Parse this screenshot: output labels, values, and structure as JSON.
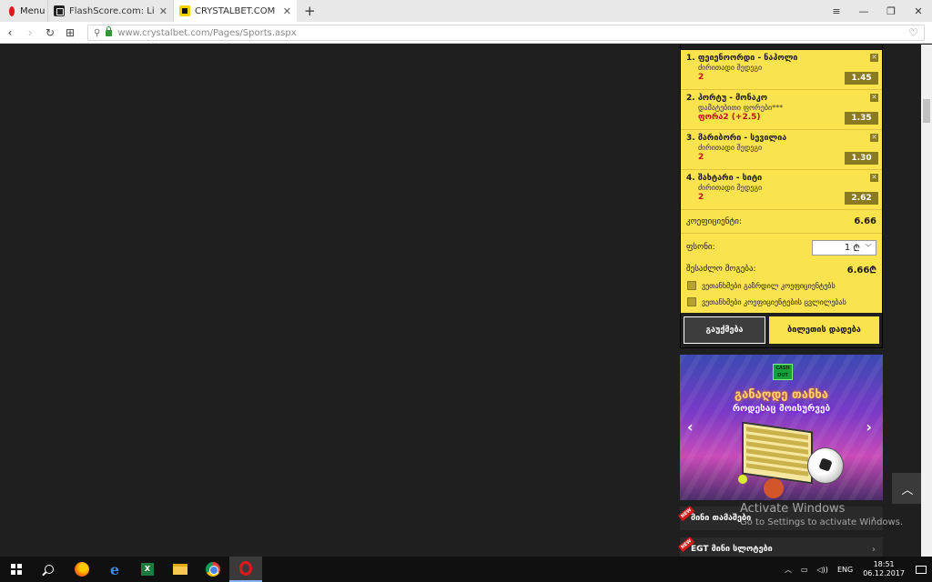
{
  "browser": {
    "menu_label": "Menu",
    "tabs": [
      {
        "title": "FlashScore.com: Live Socc",
        "close": "✕"
      },
      {
        "title": "CRYSTALBET.COM - ონლა",
        "close": "✕"
      }
    ],
    "new_tab": "+",
    "url": "www.crystalbet.com/Pages/Sports.aspx"
  },
  "betslip": {
    "bets": [
      {
        "name": "1. ფეიენოორდი - ნაპოლი",
        "market": "ძირითადი შედეგი",
        "pick": "2",
        "odds": "1.45"
      },
      {
        "name": "2. პორტუ - მონაკო",
        "market": "დამატებითი ფორები***",
        "pick": "ფორა2 (+2.5)",
        "odds": "1.35"
      },
      {
        "name": "3. მარიბორი - სევილია",
        "market": "ძირითადი შედეგი",
        "pick": "2",
        "odds": "1.30"
      },
      {
        "name": "4. შახტარი - სიტი",
        "market": "ძირითადი შედეგი",
        "pick": "2",
        "odds": "2.62"
      }
    ],
    "coefficient_label": "კოეფიციენტი:",
    "coefficient_value": "6.66",
    "stake_label": "ფსონი:",
    "stake_value": "1",
    "currency": "₾",
    "possible_win_label": "შესაძლო მოგება:",
    "possible_win_value": "6.66₾",
    "checkbox1": "ვეთანხმები გაზრდილ კოეფიციენტებს",
    "checkbox2": "ვეთანხმები კოეფიციენტების ცვლილებას",
    "reset_button": "გაუქმება",
    "place_button": "ბილეთის დადება"
  },
  "banner": {
    "badge": "CASH OUT",
    "title_line1": "განაღდე თანხა",
    "title_line2": "როდესაც მოისურვებ"
  },
  "promos": [
    {
      "badge": "NEW",
      "label": "მინი თამაშები"
    },
    {
      "badge": "NEW",
      "label": "EGT მინი სლოტები"
    }
  ],
  "watermark": {
    "line1": "Activate Windows",
    "line2": "Go to Settings to activate Windows."
  },
  "taskbar": {
    "language": "ENG",
    "time": "18:51",
    "date": "06.12.2017"
  }
}
